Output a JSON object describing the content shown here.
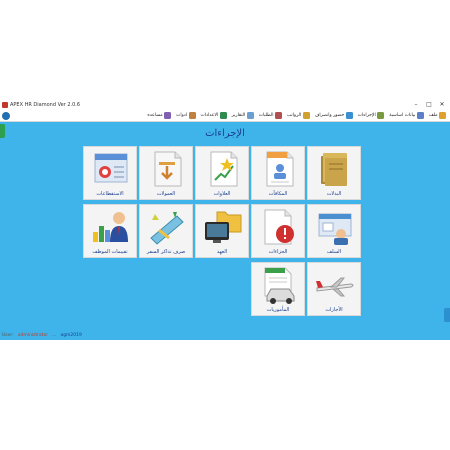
{
  "window": {
    "title": "APEX HR Diamond Ver 2.0.6",
    "minimize": "–",
    "maximize": "□",
    "close": "✕"
  },
  "menu": [
    {
      "label": "ملف",
      "icon": "folder-icon",
      "color": "#e0a030"
    },
    {
      "label": "بيانات اساسية",
      "icon": "database-icon",
      "color": "#5b7fc8"
    },
    {
      "label": "الإجراءات",
      "icon": "tasks-icon",
      "color": "#7a9a40"
    },
    {
      "label": "حضور وانصراف",
      "icon": "clock-icon",
      "color": "#3a8fd0"
    },
    {
      "label": "الرواتب",
      "icon": "money-icon",
      "color": "#d0a030"
    },
    {
      "label": "الطلبات",
      "icon": "requests-icon",
      "color": "#b05050"
    },
    {
      "label": "التقارير",
      "icon": "report-icon",
      "color": "#6aa0d0"
    },
    {
      "label": "الاعدادات",
      "icon": "settings-icon",
      "color": "#2f8a50"
    },
    {
      "label": "ادوات",
      "icon": "tools-icon",
      "color": "#c08040"
    },
    {
      "label": "مساعده",
      "icon": "help-icon",
      "color": "#8060b0"
    }
  ],
  "page_title": "الإجراءات",
  "tiles": [
    {
      "label": "البدلات",
      "icon": "allowances-folder-icon"
    },
    {
      "label": "المكافآت",
      "icon": "rewards-document-icon"
    },
    {
      "label": "العلاوات",
      "icon": "raises-document-icon"
    },
    {
      "label": "العمولات",
      "icon": "commissions-document-icon"
    },
    {
      "label": "الاستقطاعات",
      "icon": "deductions-card-icon"
    },
    {
      "label": "السلف",
      "icon": "advances-card-icon"
    },
    {
      "label": "الجزاءات",
      "icon": "penalties-alert-icon"
    },
    {
      "label": "العهد",
      "icon": "custody-folder-icon"
    },
    {
      "label": "صرف تذاكر السفر",
      "icon": "travel-tickets-icon"
    },
    {
      "label": "تقييمات الموظف",
      "icon": "employee-evaluation-icon"
    },
    {
      "label": "الأجازات",
      "icon": "vacation-plane-icon"
    },
    {
      "label": "المأموريات",
      "icon": "missions-car-icon"
    }
  ],
  "status": {
    "user_prefix": "User:",
    "user": "administrator",
    "dots": "...",
    "company": "agm2019",
    "user_color": "#c0392b",
    "company_color": "#1a3f8f"
  }
}
